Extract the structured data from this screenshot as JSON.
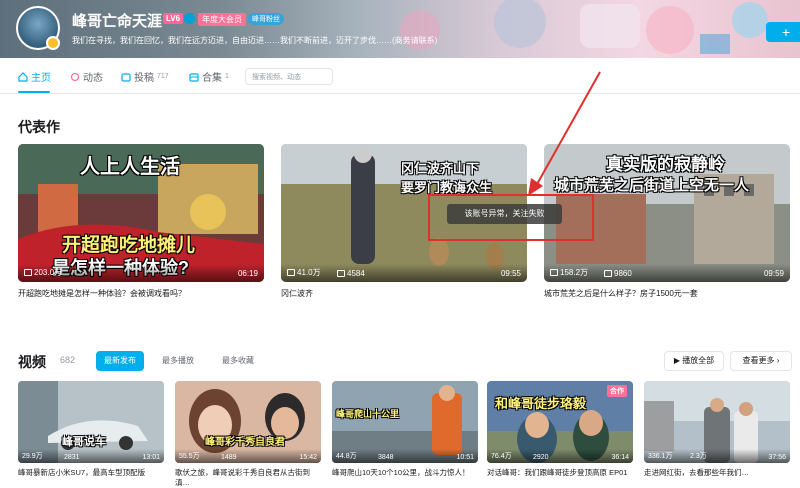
{
  "header": {
    "username": "峰哥亡命天涯",
    "level": "LV6",
    "vip": "年度大会员",
    "fan_badge": "峰哥粉丝",
    "signature": "我们在寻找，我们在回忆，我们在远方迈进，自由迈进……我们不断前进，迈开了步伐……(商务请联系)",
    "follow_label": "+"
  },
  "nav": {
    "home": "主页",
    "dynamic": "动态",
    "posts": "投稿",
    "posts_count": "717",
    "collections": "合集",
    "collections_count": "1",
    "search_placeholder": "搜索视频、动态"
  },
  "featured": {
    "title": "代表作",
    "items": [
      {
        "caption_top": "人上人生活",
        "caption_bottom": "开超跑吃地摊儿",
        "caption_bottom2": "是怎样一种体验?",
        "views": "203.0万",
        "danmaku": "9.8万",
        "duration": "06:19",
        "title": "开超跑吃地摊是怎样一种体验？会被调戏看吗？"
      },
      {
        "caption_top": "冈仁波齐山下",
        "caption_bottom": "要罗门教诲众生",
        "views": "41.0万",
        "danmaku": "4584",
        "duration": "09:55",
        "title": "冈仁波齐"
      },
      {
        "caption_top": "真实版的寂静岭",
        "caption_bottom": "城市荒芜之后街道上空无一人",
        "views": "158.2万",
        "danmaku": "9860",
        "duration": "09:59",
        "title": "城市荒芜之后是什么样子？房子1500元一套"
      }
    ]
  },
  "tooltip": "该账号异常，关注失败",
  "videos": {
    "title": "视频",
    "count": "682",
    "sort": [
      "最新发布",
      "最多播放",
      "最多收藏"
    ],
    "play_all": "▶ 播放全部",
    "see_more": "查看更多 ›",
    "items": [
      {
        "caption": "峰哥说车",
        "views": "29.9万",
        "danmaku": "2831",
        "duration": "13:01",
        "title": "峰哥暴新店小米SU7，最高车型顶配版"
      },
      {
        "caption": "峰哥彩千秀自良君",
        "views": "55.5万",
        "danmaku": "1489",
        "duration": "15:42",
        "title": "歌伏之旅，峰哥说彩千秀自良君从古街到滇…"
      },
      {
        "caption": "峰哥爬山十公里",
        "views": "44.8万",
        "danmaku": "3848",
        "duration": "10:51",
        "title": "峰哥爬山10天10个10公里，战斗力惊人！"
      },
      {
        "caption": "和峰哥徒步珞毅",
        "views": "76.4万",
        "danmaku": "2920",
        "duration": "36:14",
        "title": "对话峰哥：我们跟峰哥徒步登顶高原 EP01"
      },
      {
        "caption": "",
        "views": "336.1万",
        "danmaku": "2.3万",
        "duration": "37:56",
        "title": "走进网红街，去看那些年我们…"
      }
    ]
  },
  "colors": {
    "accent": "#00aeec",
    "annot": "#e0302d"
  }
}
